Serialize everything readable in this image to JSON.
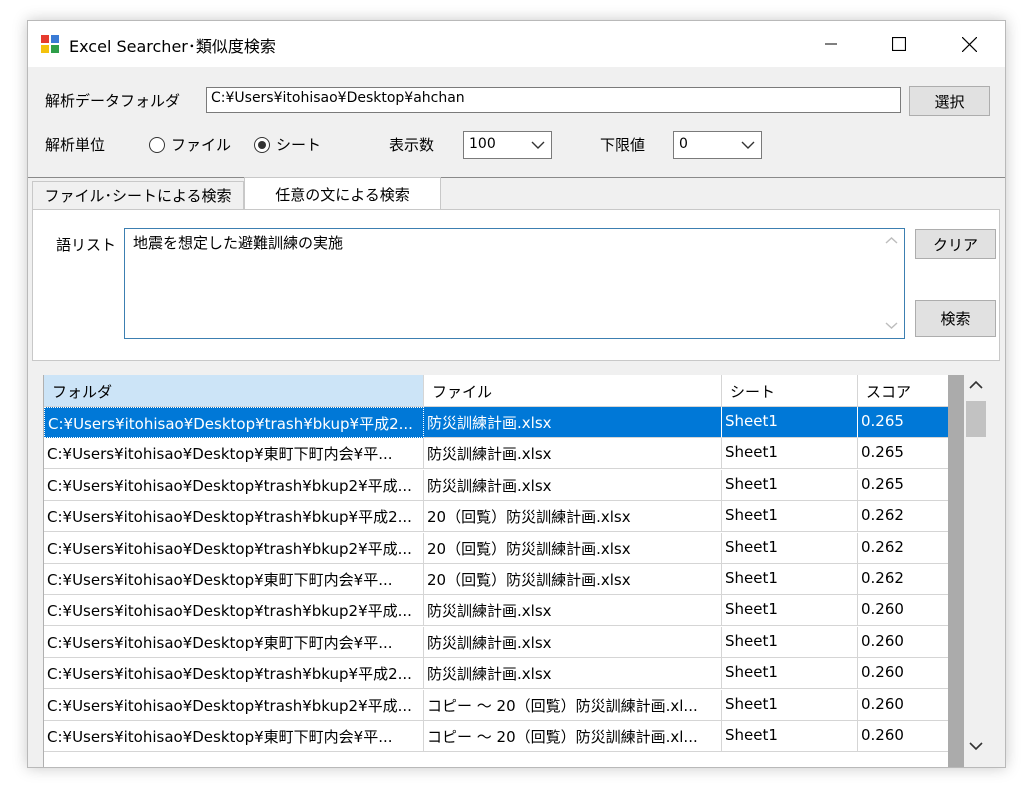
{
  "window": {
    "title": "Excel Searcher･類似度検索",
    "minimize": "—",
    "maximize": "☐",
    "close": "✕"
  },
  "folder": {
    "label": "解析データフォルダ",
    "value": "C:¥Users¥itohisao¥Desktop¥ahchan",
    "select_button": "選択"
  },
  "options": {
    "unit_label": "解析単位",
    "radio_file": "ファイル",
    "radio_sheet": "シート",
    "selected_unit": "シート",
    "display_count_label": "表示数",
    "display_count_value": "100",
    "lower_limit_label": "下限値",
    "lower_limit_value": "0"
  },
  "tabs": [
    {
      "label": "ファイル･シートによる検索"
    },
    {
      "label": "任意の文による検索"
    }
  ],
  "search_panel": {
    "word_list_label": "語リスト",
    "word_list_value": "地震を想定した避難訓練の実施",
    "clear_button": "クリア",
    "search_button": "検索"
  },
  "results": {
    "columns": [
      "フォルダ",
      "ファイル",
      "シート",
      "スコア"
    ],
    "rows": [
      [
        "C:¥Users¥itohisao¥Desktop¥trash¥bkup¥平成2...",
        "防災訓練計画.xlsx",
        "Sheet1",
        "0.265"
      ],
      [
        "C:¥Users¥itohisao¥Desktop¥東町下町内会¥平...",
        "防災訓練計画.xlsx",
        "Sheet1",
        "0.265"
      ],
      [
        "C:¥Users¥itohisao¥Desktop¥trash¥bkup2¥平成...",
        "防災訓練計画.xlsx",
        "Sheet1",
        "0.265"
      ],
      [
        "C:¥Users¥itohisao¥Desktop¥trash¥bkup¥平成2...",
        "20（回覧）防災訓練計画.xlsx",
        "Sheet1",
        "0.262"
      ],
      [
        "C:¥Users¥itohisao¥Desktop¥trash¥bkup2¥平成...",
        "20（回覧）防災訓練計画.xlsx",
        "Sheet1",
        "0.262"
      ],
      [
        "C:¥Users¥itohisao¥Desktop¥東町下町内会¥平...",
        "20（回覧）防災訓練計画.xlsx",
        "Sheet1",
        "0.262"
      ],
      [
        "C:¥Users¥itohisao¥Desktop¥trash¥bkup2¥平成...",
        "防災訓練計画.xlsx",
        "Sheet1",
        "0.260"
      ],
      [
        "C:¥Users¥itohisao¥Desktop¥東町下町内会¥平...",
        "防災訓練計画.xlsx",
        "Sheet1",
        "0.260"
      ],
      [
        "C:¥Users¥itohisao¥Desktop¥trash¥bkup¥平成2...",
        "防災訓練計画.xlsx",
        "Sheet1",
        "0.260"
      ],
      [
        "C:¥Users¥itohisao¥Desktop¥trash¥bkup2¥平成...",
        "コピー ～ 20（回覧）防災訓練計画.xl...",
        "Sheet1",
        "0.260"
      ],
      [
        "C:¥Users¥itohisao¥Desktop¥東町下町内会¥平...",
        "コピー ～ 20（回覧）防災訓練計画.xl...",
        "Sheet1",
        "0.260"
      ]
    ],
    "selected_row": 0
  }
}
